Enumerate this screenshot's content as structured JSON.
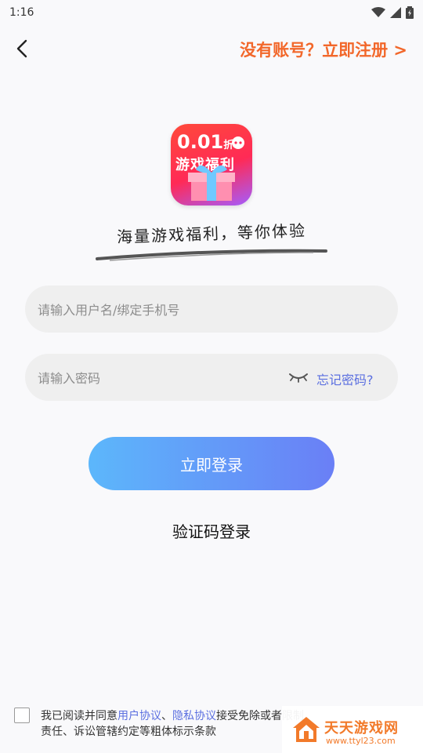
{
  "status_bar": {
    "time": "1:16"
  },
  "nav": {
    "register_link": "没有账号？立即注册 >"
  },
  "logo": {
    "line1": "0.01",
    "line1_suffix": "折",
    "line2": "游戏福利"
  },
  "tagline": "海量游戏福利，等你体验",
  "form": {
    "username_placeholder": "请输入用户名/绑定手机号",
    "password_placeholder": "请输入密码",
    "forgot_password": "忘记密码?",
    "login_button": "立即登录",
    "sms_login": "验证码登录"
  },
  "agreement": {
    "prefix": "我已阅读并同意",
    "user_agreement": "用户协议",
    "separator": "、",
    "privacy_agreement": "隐私协议",
    "suffix": "接受免除或者限制责任、诉讼管辖约定等粗体标示条款"
  },
  "watermark": {
    "title": "天天游戏网",
    "url": "www.ttyl23.com"
  },
  "colors": {
    "accent_orange": "#f2672a",
    "link_blue": "#5b6fe0",
    "button_start": "#5cb7fb",
    "button_end": "#6a7ff6"
  }
}
